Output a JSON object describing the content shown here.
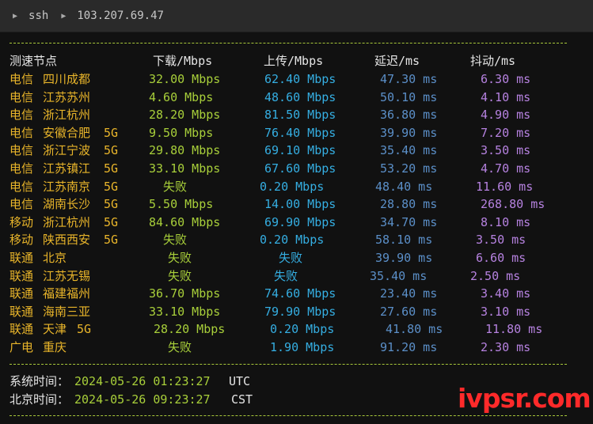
{
  "titlebar": {
    "path": [
      "ssh",
      "103.207.69.47"
    ]
  },
  "headers": {
    "node": "测速节点",
    "download": "下载/Mbps",
    "upload": "上传/Mbps",
    "latency": "延迟/ms",
    "jitter": "抖动/ms"
  },
  "rows": [
    {
      "isp": "电信",
      "city": "四川成都",
      "g5": "",
      "dl": "32.00 Mbps",
      "ul": "62.40 Mbps",
      "lat": "47.30 ms",
      "jit": "6.30 ms"
    },
    {
      "isp": "电信",
      "city": "江苏苏州",
      "g5": "",
      "dl": "4.60 Mbps",
      "ul": "48.60 Mbps",
      "lat": "50.10 ms",
      "jit": "4.10 ms"
    },
    {
      "isp": "电信",
      "city": "浙江杭州",
      "g5": "",
      "dl": "28.20 Mbps",
      "ul": "81.50 Mbps",
      "lat": "36.80 ms",
      "jit": "4.90 ms"
    },
    {
      "isp": "电信",
      "city": "安徽合肥",
      "g5": "5G",
      "dl": "9.50 Mbps",
      "ul": "76.40 Mbps",
      "lat": "39.90 ms",
      "jit": "7.20 ms"
    },
    {
      "isp": "电信",
      "city": "浙江宁波",
      "g5": "5G",
      "dl": "29.80 Mbps",
      "ul": "69.10 Mbps",
      "lat": "35.40 ms",
      "jit": "3.50 ms"
    },
    {
      "isp": "电信",
      "city": "江苏镇江",
      "g5": "5G",
      "dl": "33.10 Mbps",
      "ul": "67.60 Mbps",
      "lat": "53.20 ms",
      "jit": "4.70 ms"
    },
    {
      "isp": "电信",
      "city": "江苏南京",
      "g5": "5G",
      "dl": "失败",
      "ul": "0.20 Mbps",
      "lat": "48.40 ms",
      "jit": "11.60 ms"
    },
    {
      "isp": "电信",
      "city": "湖南长沙",
      "g5": "5G",
      "dl": "5.50 Mbps",
      "ul": "14.00 Mbps",
      "lat": "28.80 ms",
      "jit": "268.80 ms"
    },
    {
      "isp": "移动",
      "city": "浙江杭州",
      "g5": "5G",
      "dl": "84.60 Mbps",
      "ul": "69.90 Mbps",
      "lat": "34.70 ms",
      "jit": "8.10 ms"
    },
    {
      "isp": "移动",
      "city": "陕西西安",
      "g5": "5G",
      "dl": "失败",
      "ul": "0.20 Mbps",
      "lat": "58.10 ms",
      "jit": "3.50 ms"
    },
    {
      "isp": "联通",
      "city": "北京",
      "g5": "",
      "dl": "失败",
      "ul": "失败",
      "lat": "39.90 ms",
      "jit": "6.60 ms"
    },
    {
      "isp": "联通",
      "city": "江苏无锡",
      "g5": "",
      "dl": "失败",
      "ul": "失败",
      "lat": "35.40 ms",
      "jit": "2.50 ms"
    },
    {
      "isp": "联通",
      "city": "福建福州",
      "g5": "",
      "dl": "36.70 Mbps",
      "ul": "74.60 Mbps",
      "lat": "23.40 ms",
      "jit": "3.40 ms"
    },
    {
      "isp": "联通",
      "city": "海南三亚",
      "g5": "",
      "dl": "33.10 Mbps",
      "ul": "79.90 Mbps",
      "lat": "27.60 ms",
      "jit": "3.10 ms"
    },
    {
      "isp": "联通",
      "city": "天津",
      "g5": "5G",
      "dl": "28.20 Mbps",
      "ul": "0.20 Mbps",
      "lat": "41.80 ms",
      "jit": "11.80 ms"
    },
    {
      "isp": "广电",
      "city": "重庆",
      "g5": "",
      "dl": "失败",
      "ul": "1.90 Mbps",
      "lat": "91.20 ms",
      "jit": "2.30 ms"
    }
  ],
  "footer": {
    "system_label": "系统时间：",
    "system_time": "2024-05-26 01:23:27",
    "system_tz": "UTC",
    "beijing_label": "北京时间：",
    "beijing_time": "2024-05-26 09:23:27",
    "beijing_tz": "CST"
  },
  "watermark": "ivpsr.com",
  "colors": {
    "background": "#111111",
    "separator": "#a8c83a",
    "isp": "#e9b52a",
    "download": "#a8cf3a",
    "upload": "#35aee2",
    "latency": "#5b8fc8",
    "jitter": "#b682e0",
    "watermark": "#ff2a2a"
  }
}
